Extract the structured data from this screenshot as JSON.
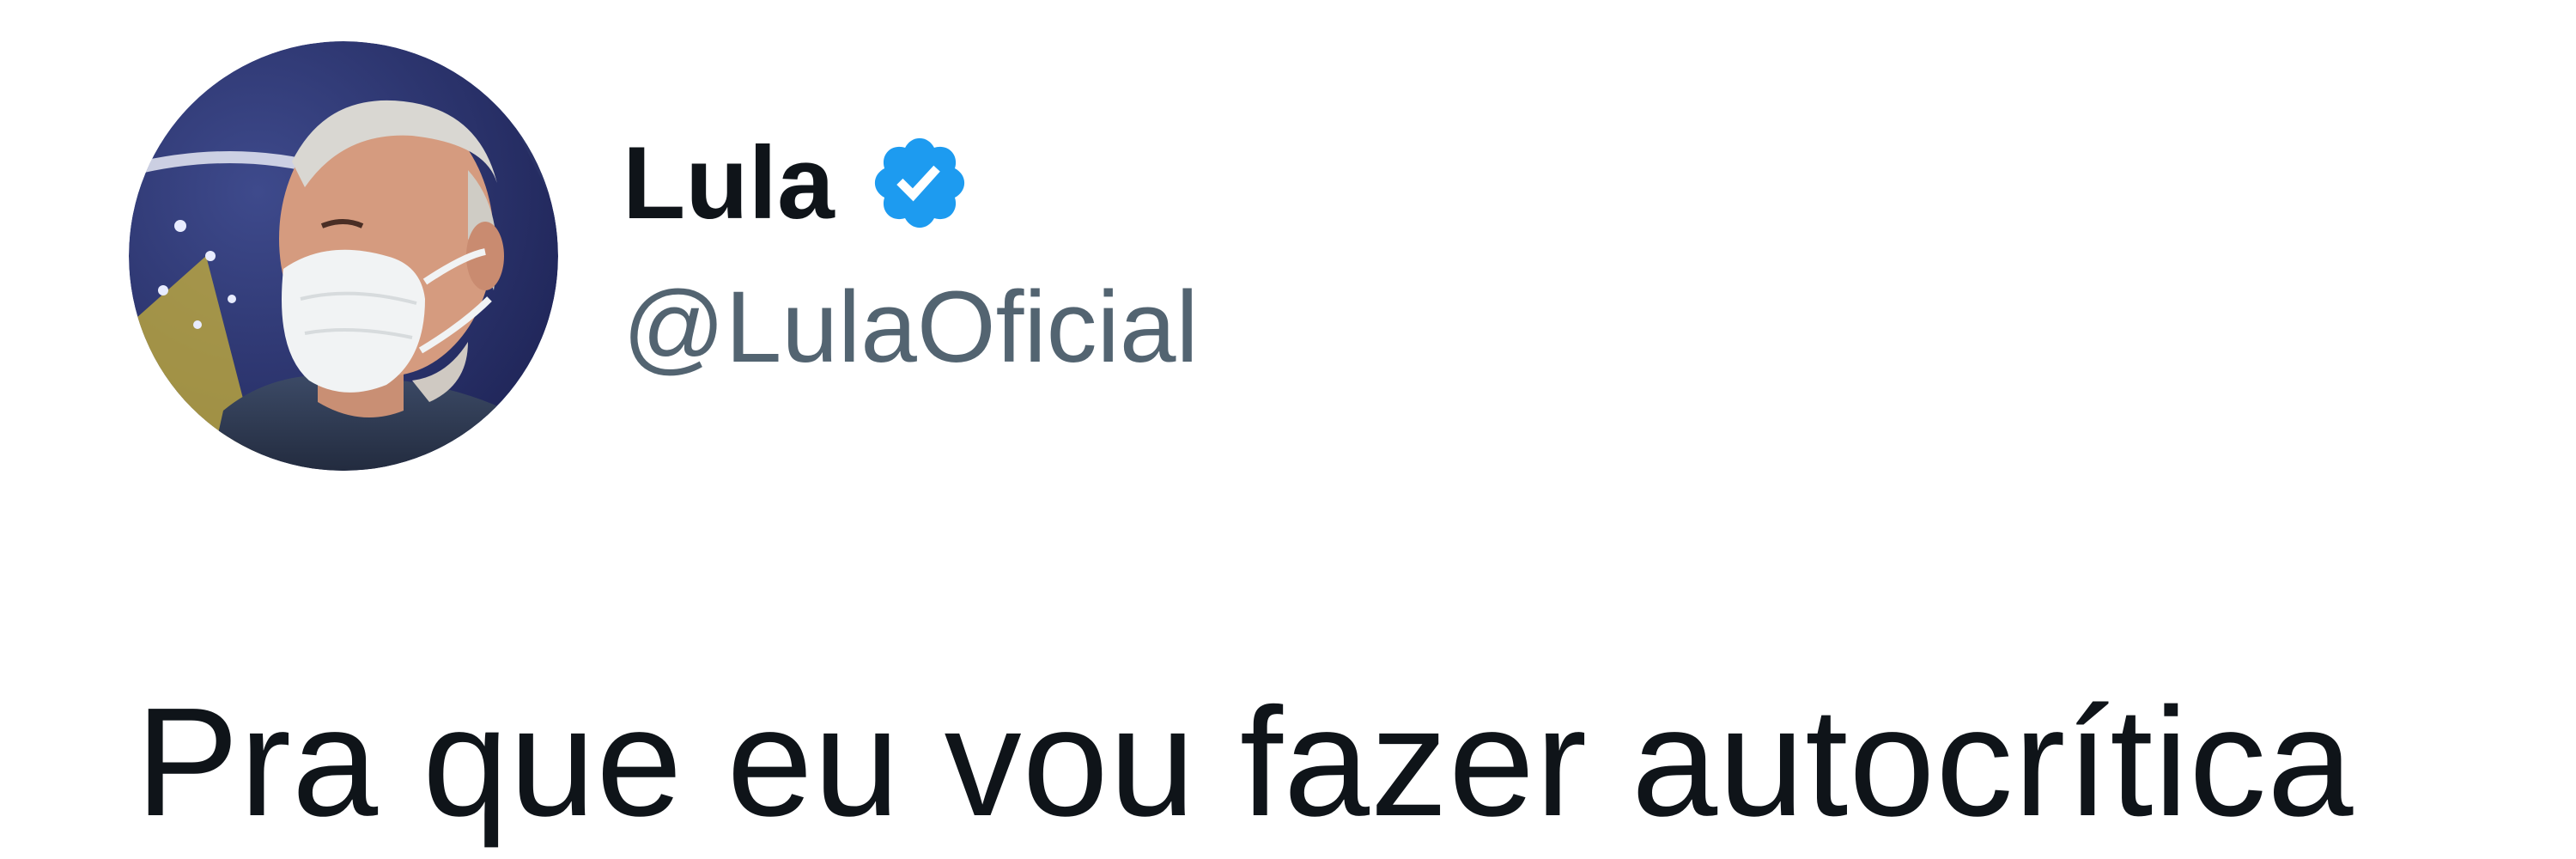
{
  "tweet": {
    "author": {
      "display_name": "Lula",
      "handle": "@LulaOficial",
      "verified": true,
      "avatar_icon": "profile-photo-avatar"
    },
    "text": "Pra que eu vou fazer autocrítica"
  },
  "colors": {
    "background": "#ffffff",
    "text_primary": "#0f1419",
    "text_secondary": "#536471",
    "verified_blue": "#1d9bf0"
  }
}
